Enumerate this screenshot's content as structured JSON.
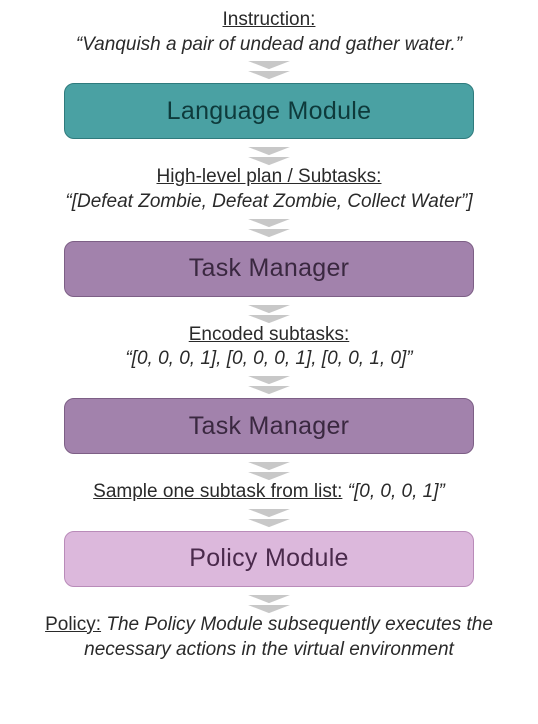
{
  "captions": {
    "instruction": {
      "heading": "Instruction:",
      "payload": "“Vanquish a pair of undead and gather water.”"
    },
    "plan": {
      "heading": "High-level plan / Subtasks:",
      "payload": "“[Defeat Zombie, Defeat Zombie, Collect Water”]"
    },
    "encoded": {
      "heading": "Encoded subtasks:",
      "payload": "“[0, 0, 0, 1], [0, 0, 0, 1], [0, 0, 1, 0]”"
    },
    "sample": {
      "heading": "Sample one subtask from list:",
      "payload": "“[0, 0, 0, 1]”"
    },
    "policy": {
      "heading": "Policy:",
      "payload": "The Policy Module subsequently executes the necessary actions in the virtual environment"
    }
  },
  "boxes": {
    "lang": "Language Module",
    "task1": "Task Manager",
    "task2": "Task Manager",
    "policy": "Policy Module"
  },
  "colors": {
    "lang_bg": "#4aa1a3",
    "task_bg": "#a282ac",
    "policy_bg": "#dcb8dc",
    "arrow_fill": "#c8c8c8"
  }
}
